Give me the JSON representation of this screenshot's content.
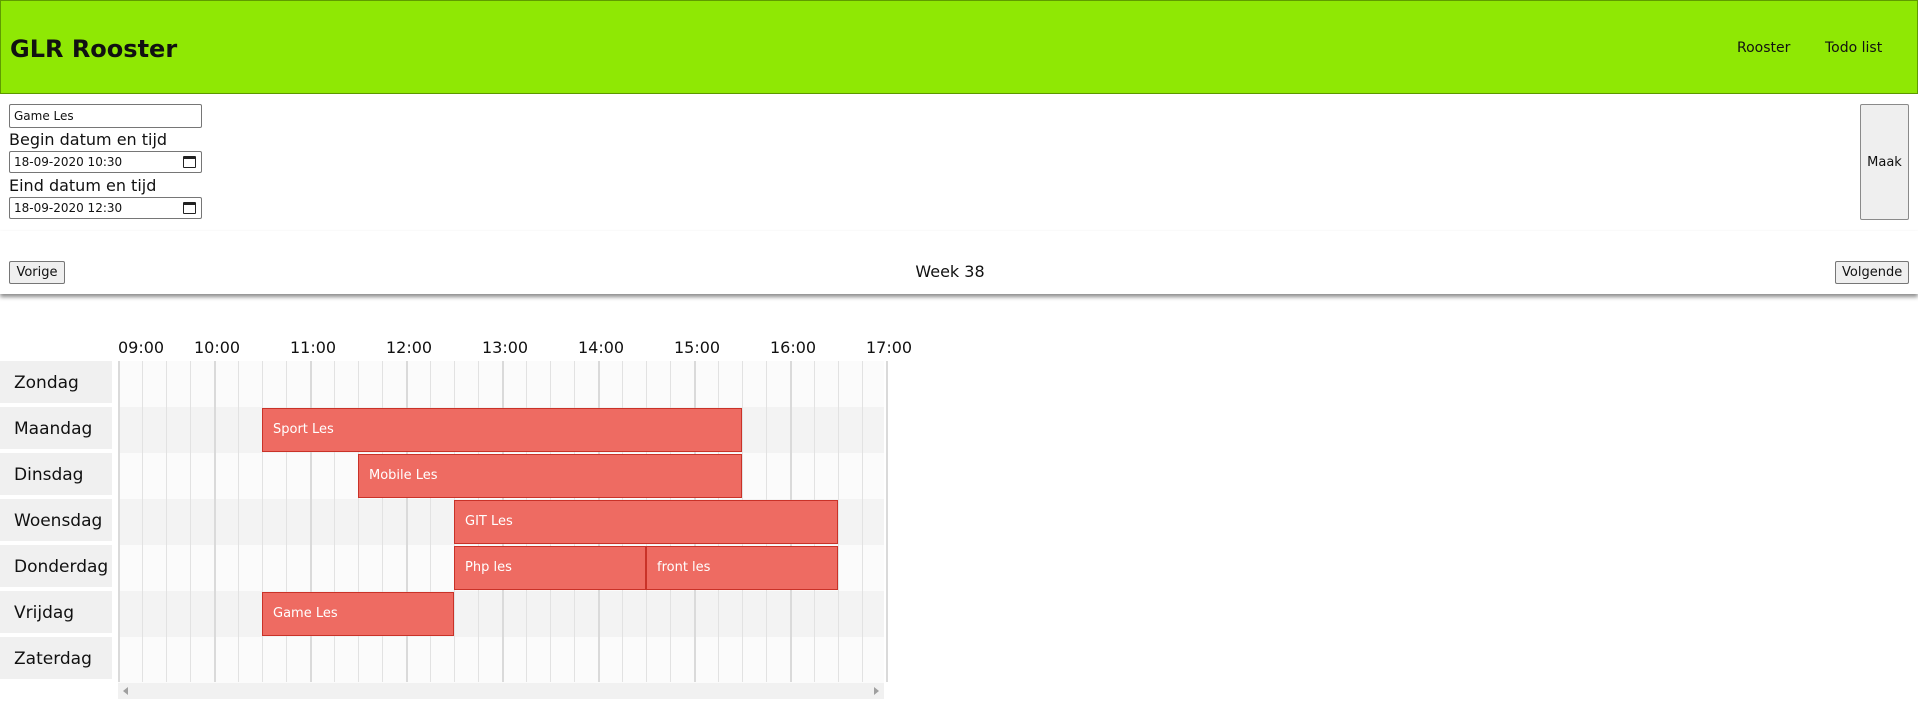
{
  "header": {
    "title": "GLR Rooster",
    "nav": [
      {
        "label": "Rooster"
      },
      {
        "label": "Todo list"
      }
    ],
    "background": "#8fe804"
  },
  "form": {
    "name_value": "Game Les",
    "begin_label": "Begin datum en tijd",
    "begin_value": "18-09-2020 10:30",
    "end_label": "Eind datum en tijd",
    "end_value": "18-09-2020 12:30",
    "submit_label": "Maak"
  },
  "week_nav": {
    "prev_label": "Vorige",
    "week_label": "Week 38",
    "next_label": "Volgende"
  },
  "schedule": {
    "times": [
      "09:00",
      "10:00",
      "11:00",
      "12:00",
      "13:00",
      "14:00",
      "15:00",
      "16:00",
      "17:00"
    ],
    "days": [
      "Zondag",
      "Maandag",
      "Dinsdag",
      "Woensdag",
      "Donderdag",
      "Vrijdag",
      "Zaterdag"
    ],
    "events": [
      {
        "title": "Sport Les",
        "day": 1,
        "start": "10:30",
        "end": "15:30"
      },
      {
        "title": "Mobile Les",
        "day": 2,
        "start": "11:30",
        "end": "15:30"
      },
      {
        "title": "GIT Les",
        "day": 3,
        "start": "12:30",
        "end": "16:30"
      },
      {
        "title": "Php les",
        "day": 4,
        "start": "12:30",
        "end": "14:30"
      },
      {
        "title": "front les",
        "day": 4,
        "start": "14:30",
        "end": "16:30"
      },
      {
        "title": "Game Les",
        "day": 5,
        "start": "10:30",
        "end": "12:30"
      }
    ],
    "event_color": "#ee6b62"
  }
}
